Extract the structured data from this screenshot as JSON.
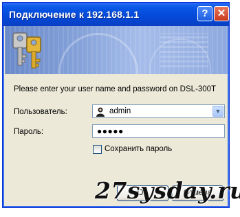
{
  "window": {
    "title": "Подключение к 192.168.1.1",
    "help_label": "?",
    "close_label": "✕"
  },
  "dialog": {
    "prompt": "Please enter your user name and password on DSL-300T",
    "user_label": "Пользователь:",
    "user_value": "admin",
    "password_label": "Пароль:",
    "password_value": "●●●●●",
    "remember_label": "Сохранить пароль",
    "remember_checked": false,
    "ok_label": "ОК",
    "cancel_label": "Отмена"
  },
  "watermark": "27sysday.ru",
  "icons": {
    "banner": "keys-icon",
    "user": "user-icon",
    "dropdown": "chevron-down-icon"
  },
  "colors": {
    "titlebar": "#0449d8",
    "dialog_bg": "#ece9d8",
    "input_border": "#7f9db9"
  }
}
